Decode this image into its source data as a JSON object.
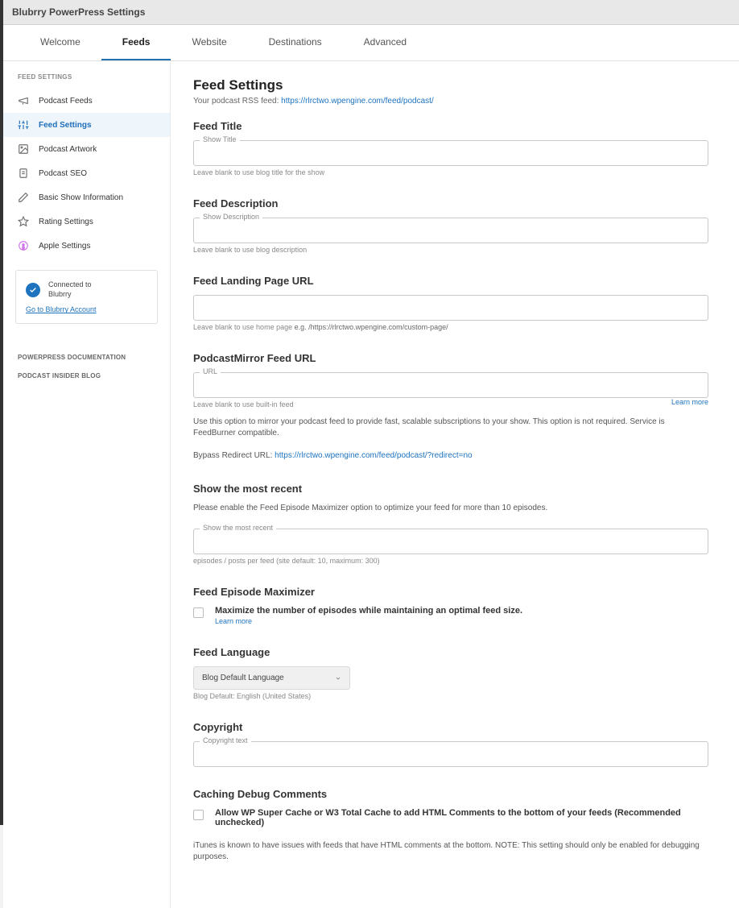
{
  "header": {
    "title": "Blubrry PowerPress Settings"
  },
  "tabs": [
    "Welcome",
    "Feeds",
    "Website",
    "Destinations",
    "Advanced"
  ],
  "active_tab": "Feeds",
  "sidebar": {
    "heading": "FEED SETTINGS",
    "items": [
      "Podcast Feeds",
      "Feed Settings",
      "Podcast Artwork",
      "Podcast SEO",
      "Basic Show Information",
      "Rating Settings",
      "Apple Settings"
    ],
    "box": {
      "connected_line1": "Connected to",
      "connected_line2": "Blubrry",
      "account_link": "Go to Blubrry Account"
    },
    "doc_links": [
      "POWERPRESS DOCUMENTATION",
      "PODCAST INSIDER BLOG"
    ]
  },
  "page": {
    "title": "Feed Settings",
    "subtitle_prefix": "Your podcast RSS feed: ",
    "subtitle_link": "https://rlrctwo.wpengine.com/feed/podcast/"
  },
  "sections": {
    "feed_title": {
      "heading": "Feed Title",
      "label": "Show Title",
      "help": "Leave blank to use blog title for the show"
    },
    "feed_desc": {
      "heading": "Feed Description",
      "label": "Show Description",
      "help": "Leave blank to use blog description"
    },
    "landing": {
      "heading": "Feed Landing Page URL",
      "help_prefix": "Leave blank to use home page ",
      "help_ex": "e.g. /https://rlrctwo.wpengine.com/custom-page/"
    },
    "mirror": {
      "heading": "PodcastMirror Feed URL",
      "label": "URL",
      "help": "Leave blank to use built-in feed",
      "learn_more": "Learn more",
      "desc": "Use this option to mirror your podcast feed to provide fast, scalable subscriptions to your show. This option is not required. Service is FeedBurner compatible.",
      "bypass_label": "Bypass Redirect URL: ",
      "bypass_link": "https://rlrctwo.wpengine.com/feed/podcast/?redirect=no"
    },
    "recent": {
      "heading": "Show the most recent",
      "desc": "Please enable the Feed Episode Maximizer option to optimize your feed for more than 10 episodes.",
      "label": "Show the most recent",
      "help": "episodes / posts per feed (site default: 10, maximum: 300)"
    },
    "maximizer": {
      "heading": "Feed Episode Maximizer",
      "label": "Maximize the number of episodes while maintaining an optimal feed size.",
      "learn_more": "Learn more"
    },
    "language": {
      "heading": "Feed Language",
      "value": "Blog Default Language",
      "help": "Blog Default: English (United States)"
    },
    "copyright": {
      "heading": "Copyright",
      "label": "Copyright text"
    },
    "caching": {
      "heading": "Caching Debug Comments",
      "label": "Allow WP Super Cache or W3 Total Cache to add HTML Comments to the bottom of your feeds (Recommended unchecked)",
      "desc": "iTunes is known to have issues with feeds that have HTML comments at the bottom. NOTE: This setting should only be enabled for debugging purposes."
    }
  }
}
